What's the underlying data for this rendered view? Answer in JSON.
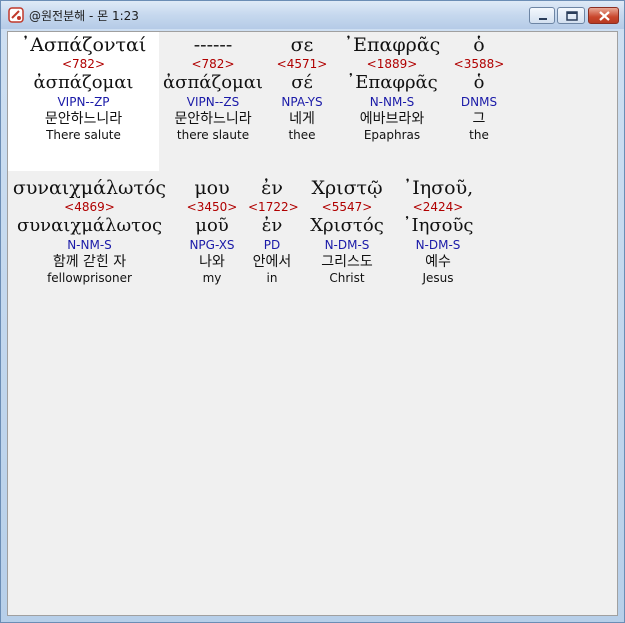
{
  "window": {
    "title": "@원전분해 - 몬 1:23",
    "colors": {
      "strong": "#b00000",
      "parsing": "#1a1aa8",
      "text": "#111111",
      "background": "#f0f0f0",
      "selected": "#ffffff"
    }
  },
  "line1": [
    {
      "greek": "᾽Ασπάζονταί",
      "strong": "<782>",
      "lemma": "ἀσπάζομαι",
      "parsing": "VIPN--ZP",
      "korean": "문안하느니라",
      "english": "There salute"
    },
    {
      "greek": "------",
      "strong": "<782>",
      "lemma": "ἀσπάζομαι",
      "parsing": "VIPN--ZS",
      "korean": "문안하느니라",
      "english": "there slaute"
    },
    {
      "greek": "σε",
      "strong": "<4571>",
      "lemma": "σέ",
      "parsing": "NPA-YS",
      "korean": "네게",
      "english": "thee"
    },
    {
      "greek": "᾽Επαφρᾶς",
      "strong": "<1889>",
      "lemma": "᾽Επαφρᾶς",
      "parsing": "N-NM-S",
      "korean": "에바브라와",
      "english": "Epaphras"
    },
    {
      "greek": "ὁ",
      "strong": "<3588>",
      "lemma": "ὁ",
      "parsing": "DNMS",
      "korean": "그",
      "english": "the"
    }
  ],
  "line2": [
    {
      "greek": "συναιχμάλωτός",
      "strong": "<4869>",
      "lemma": "συναιχμάλωτος",
      "parsing": "N-NM-S",
      "korean": "함께 갇힌 자",
      "english": "fellowprisoner"
    },
    {
      "greek": "μου",
      "strong": "<3450>",
      "lemma": "μοῦ",
      "parsing": "NPG-XS",
      "korean": "나와",
      "english": "my"
    },
    {
      "greek": "ἐν",
      "strong": "<1722>",
      "lemma": "ἐν",
      "parsing": "PD",
      "korean": "안에서",
      "english": "in"
    },
    {
      "greek": "Χριστῷ",
      "strong": "<5547>",
      "lemma": "Χριστός",
      "parsing": "N-DM-S",
      "korean": "그리스도",
      "english": "Christ"
    },
    {
      "greek": "᾽Ιησοῦ,",
      "strong": "<2424>",
      "lemma": "᾽Ιησοῦς",
      "parsing": "N-DM-S",
      "korean": "예수",
      "english": "Jesus"
    }
  ]
}
